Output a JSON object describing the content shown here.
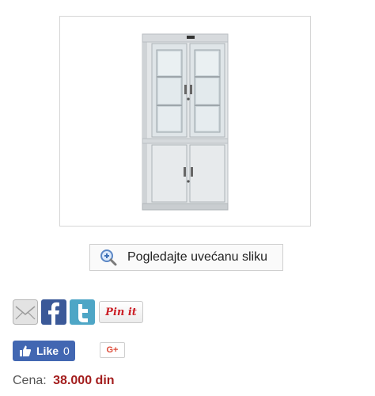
{
  "product": {
    "image_alt": "metal cabinet with glass doors"
  },
  "zoom": {
    "label": "Pogledajte uvećanu sliku",
    "icon": "magnifier-plus-icon"
  },
  "share": {
    "icons": [
      "email-icon",
      "facebook-icon",
      "twitter-icon"
    ],
    "pinit_label": "Pin it"
  },
  "facebook_like": {
    "label": "Like",
    "count": "0"
  },
  "google_plus": {
    "label": "G+"
  },
  "price": {
    "label": "Cena:",
    "value": "38.000 din"
  },
  "colors": {
    "price": "#a31d1d",
    "facebook": "#4267b2",
    "pinterest": "#cb2027",
    "google": "#dd4b39"
  }
}
